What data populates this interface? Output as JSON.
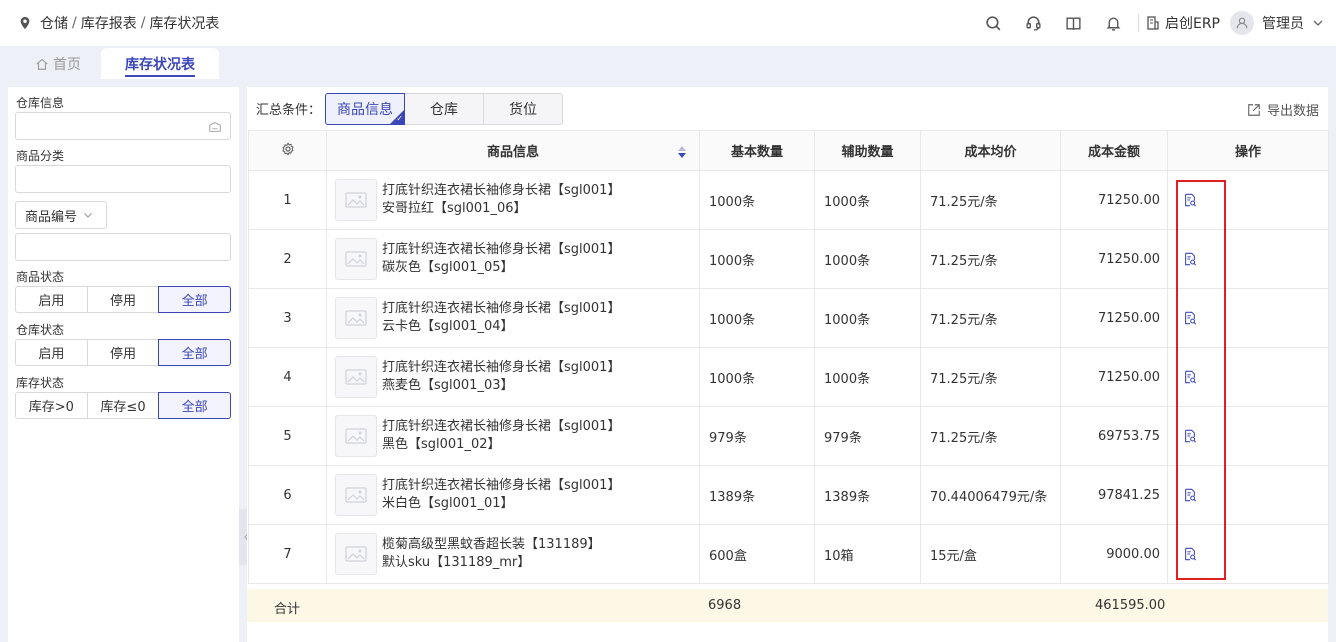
{
  "header": {
    "breadcrumb": [
      "仓储",
      "库存报表",
      "库存状况表"
    ],
    "breadcrumb_sep": "/",
    "brand": "启创ERP",
    "user": "管理员"
  },
  "tabs": {
    "home": "首页",
    "active": "库存状况表"
  },
  "filters": {
    "warehouse_info_label": "仓库信息",
    "warehouse_info_value": "",
    "category_label": "商品分类",
    "category_value": "",
    "code_select": "商品编号",
    "code_value": "",
    "product_status": {
      "label": "商品状态",
      "options": [
        "启用",
        "停用",
        "全部"
      ],
      "selected": "全部"
    },
    "warehouse_status": {
      "label": "仓库状态",
      "options": [
        "启用",
        "停用",
        "全部"
      ],
      "selected": "全部"
    },
    "stock_status": {
      "label": "库存状态",
      "options": [
        "库存>0",
        "库存≤0",
        "全部"
      ],
      "selected": "全部"
    }
  },
  "summary": {
    "label": "汇总条件：",
    "group_tabs": [
      "商品信息",
      "仓库",
      "货位"
    ],
    "selected": "商品信息",
    "export": "导出数据"
  },
  "table": {
    "columns": [
      "商品信息",
      "基本数量",
      "辅助数量",
      "成本均价",
      "成本金额",
      "操作"
    ],
    "rows": [
      {
        "idx": "1",
        "name": "打底针织连衣裙长袖修身长裙【sgl001】",
        "sku": "安哥拉红【sgl001_06】",
        "base_qty": "1000条",
        "aux_qty": "1000条",
        "avg_cost": "71.25元/条",
        "amount": "71250.00"
      },
      {
        "idx": "2",
        "name": "打底针织连衣裙长袖修身长裙【sgl001】",
        "sku": "碳灰色【sgl001_05】",
        "base_qty": "1000条",
        "aux_qty": "1000条",
        "avg_cost": "71.25元/条",
        "amount": "71250.00"
      },
      {
        "idx": "3",
        "name": "打底针织连衣裙长袖修身长裙【sgl001】",
        "sku": "云卡色【sgl001_04】",
        "base_qty": "1000条",
        "aux_qty": "1000条",
        "avg_cost": "71.25元/条",
        "amount": "71250.00"
      },
      {
        "idx": "4",
        "name": "打底针织连衣裙长袖修身长裙【sgl001】",
        "sku": "燕麦色【sgl001_03】",
        "base_qty": "1000条",
        "aux_qty": "1000条",
        "avg_cost": "71.25元/条",
        "amount": "71250.00"
      },
      {
        "idx": "5",
        "name": "打底针织连衣裙长袖修身长裙【sgl001】",
        "sku": "黑色【sgl001_02】",
        "base_qty": "979条",
        "aux_qty": "979条",
        "avg_cost": "71.25元/条",
        "amount": "69753.75"
      },
      {
        "idx": "6",
        "name": "打底针织连衣裙长袖修身长裙【sgl001】",
        "sku": "米白色【sgl001_01】",
        "base_qty": "1389条",
        "aux_qty": "1389条",
        "avg_cost": "70.44006479元/条",
        "amount": "97841.25"
      },
      {
        "idx": "7",
        "name": "榄菊高级型黑蚊香超长装【131189】",
        "sku": "默认sku【131189_mr】",
        "base_qty": "600盒",
        "aux_qty": "10箱",
        "avg_cost": "15元/盒",
        "amount": "9000.00"
      }
    ],
    "total": {
      "label": "合计",
      "base_qty": "6968",
      "amount": "461595.00"
    }
  },
  "colors": {
    "accent": "#3b47b7",
    "highlight_box": "#e02020",
    "total_bg": "#fdf8e6"
  }
}
